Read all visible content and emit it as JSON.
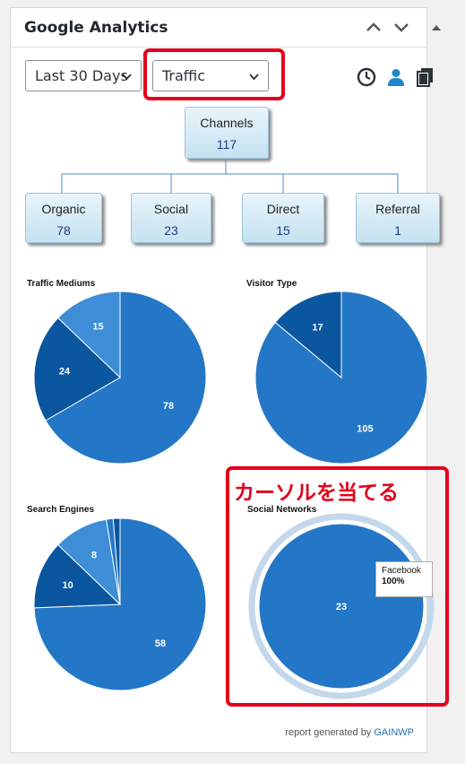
{
  "widget": {
    "title": "Google Analytics"
  },
  "controls": {
    "period_value": "Last 30 Days",
    "report_value": "Traffic"
  },
  "icons": {
    "collapse_up": "chevron-up-icon",
    "move_down": "chevron-down-icon",
    "toggle": "triangle-up-icon",
    "realtime": "clock-icon",
    "audience": "user-icon",
    "content": "pages-icon"
  },
  "channels": {
    "root": {
      "label": "Channels",
      "value": "117"
    },
    "children": [
      {
        "label": "Organic",
        "value": "78"
      },
      {
        "label": "Social",
        "value": "23"
      },
      {
        "label": "Direct",
        "value": "15"
      },
      {
        "label": "Referral",
        "value": "1"
      }
    ]
  },
  "annotation": {
    "cursor_note": "カーソルを当てる"
  },
  "tooltip": {
    "name": "Facebook",
    "pct": "100%"
  },
  "footer": {
    "prefix": "report generated by ",
    "brand": "GAINWP"
  },
  "colors": {
    "accent_red": "#e3001b",
    "pie_main": "#2477c6",
    "pie_dark": "#0a569f",
    "pie_light": "#3d8ed6",
    "link": "#2271b1"
  },
  "chart_data": [
    {
      "type": "pie",
      "title": "Traffic Mediums",
      "series": [
        {
          "values": [
            78,
            24,
            15
          ]
        }
      ],
      "labels": [
        "78",
        "24",
        "15"
      ]
    },
    {
      "type": "pie",
      "title": "Visitor Type",
      "series": [
        {
          "values": [
            105,
            17
          ]
        }
      ],
      "labels": [
        "105",
        "17"
      ]
    },
    {
      "type": "pie",
      "title": "Search Engines",
      "series": [
        {
          "values": [
            58,
            10,
            8,
            1,
            1
          ]
        }
      ],
      "labels": [
        "58",
        "10",
        "8",
        "",
        ""
      ]
    },
    {
      "type": "pie",
      "title": "Social Networks",
      "series": [
        {
          "values": [
            23
          ]
        }
      ],
      "labels": [
        "23"
      ]
    }
  ]
}
